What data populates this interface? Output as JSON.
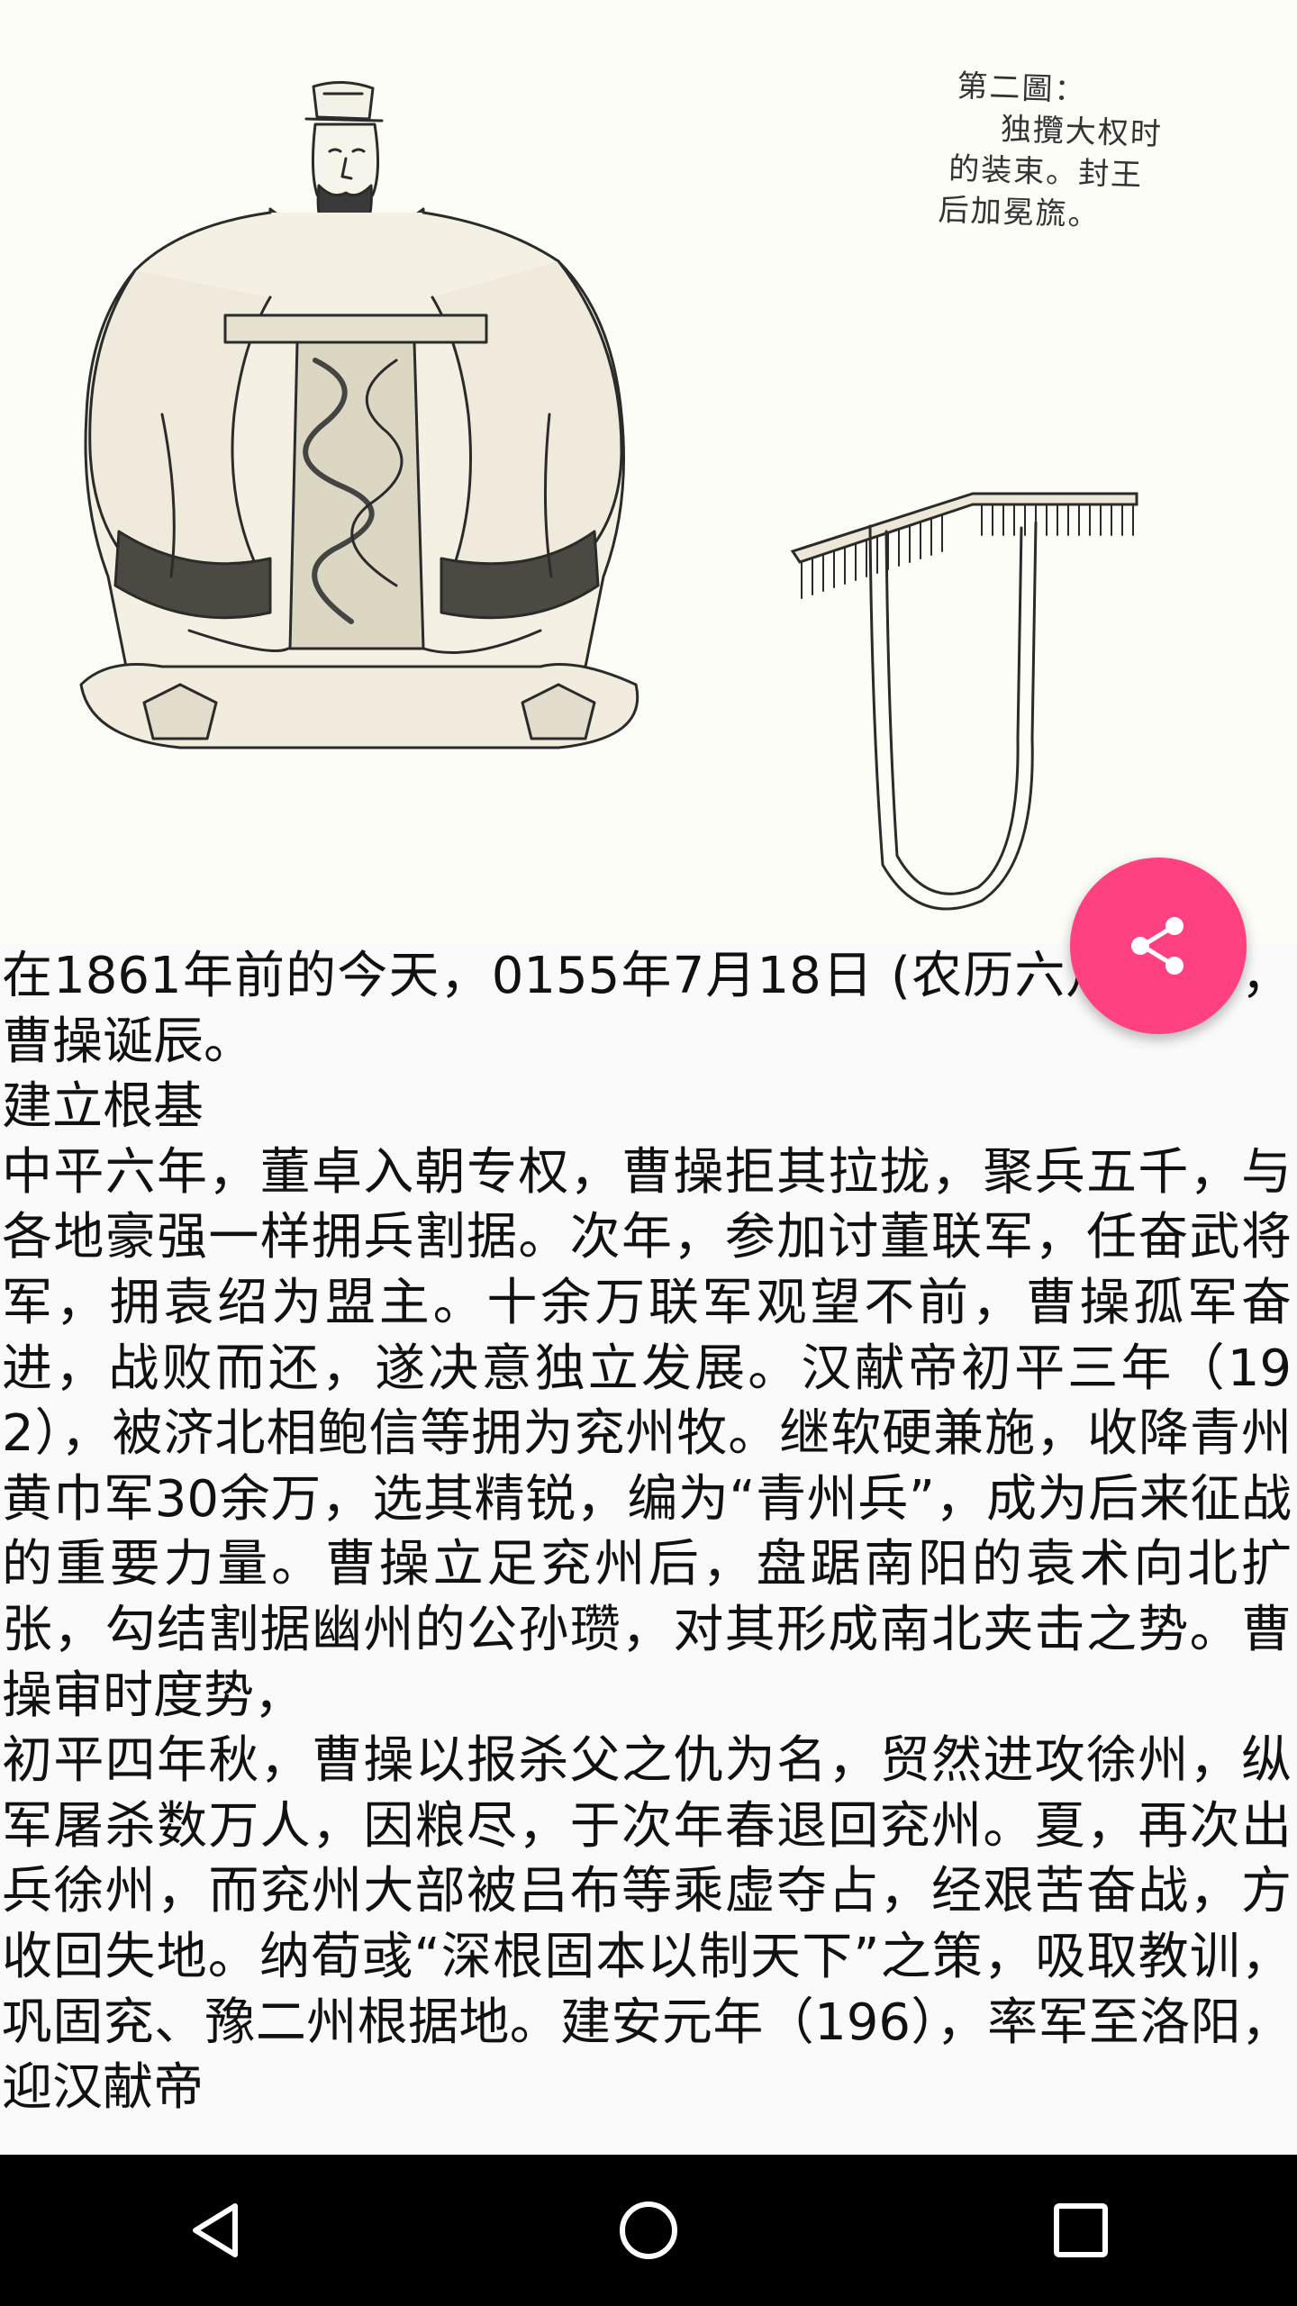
{
  "hero_image": {
    "caption_lines": [
      "第二圖：",
      "独攬大权时",
      "的装束。封王",
      "后加冕旒。"
    ]
  },
  "article": {
    "paragraphs": [
      "在1861年前的今天，0155年7月18日 (农历六月十二)，曹操诞辰。",
      "建立根基",
      "中平六年，董卓入朝专权，曹操拒其拉拢，聚兵五千，与各地豪强一样拥兵割据。次年，参加讨董联军，任奋武将军，拥袁绍为盟主。十余万联军观望不前，曹操孤军奋进，战败而还，遂决意独立发展。汉献帝初平三年（192），被济北相鲍信等拥为兖州牧。继软硬兼施，收降青州黄巾军30余万，选其精锐，编为“青州兵”，成为后来征战的重要力量。曹操立足兖州后，盘踞南阳的袁术向北扩张，勾结割据幽州的公孙瓒，对其形成南北夹击之势。曹操审时度势，",
      "初平四年秋，曹操以报杀父之仇为名，贸然进攻徐州，纵军屠杀数万人，因粮尽，于次年春退回兖州。夏，再次出兵徐州，而兖州大部被吕布等乘虚夺占，经艰苦奋战，方收回失地。纳荀彧“深根固本以制天下”之策，吸取教训，巩固兖、豫二州根据地。建安元年（196），率军至洛阳，迎汉献帝"
    ]
  },
  "fab": {
    "icon": "share-icon",
    "color": "#ff4081"
  },
  "navbar": {
    "icons": [
      "back-icon",
      "home-icon",
      "recents-icon"
    ]
  }
}
